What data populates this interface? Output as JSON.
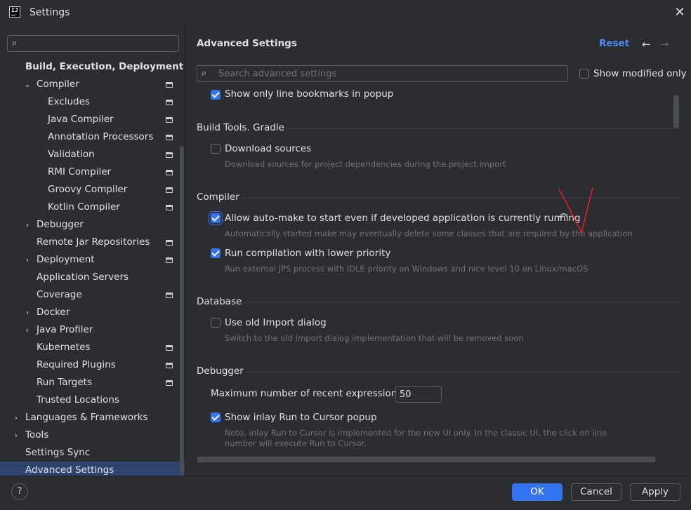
{
  "window": {
    "title": "Settings",
    "app_icon_text": "IJ",
    "close_glyph": "✕"
  },
  "sidebar": {
    "search_placeholder": "",
    "items": [
      {
        "label": "Build, Execution, Deployment",
        "indent": 0,
        "chevron": "",
        "project": false,
        "bold": true,
        "selected": false
      },
      {
        "label": "Compiler",
        "indent": 1,
        "chevron": "⌄",
        "project": true,
        "bold": false,
        "selected": false
      },
      {
        "label": "Excludes",
        "indent": 2,
        "chevron": "",
        "project": true,
        "bold": false,
        "selected": false
      },
      {
        "label": "Java Compiler",
        "indent": 2,
        "chevron": "",
        "project": true,
        "bold": false,
        "selected": false
      },
      {
        "label": "Annotation Processors",
        "indent": 2,
        "chevron": "",
        "project": true,
        "bold": false,
        "selected": false
      },
      {
        "label": "Validation",
        "indent": 2,
        "chevron": "",
        "project": true,
        "bold": false,
        "selected": false
      },
      {
        "label": "RMI Compiler",
        "indent": 2,
        "chevron": "",
        "project": true,
        "bold": false,
        "selected": false
      },
      {
        "label": "Groovy Compiler",
        "indent": 2,
        "chevron": "",
        "project": true,
        "bold": false,
        "selected": false
      },
      {
        "label": "Kotlin Compiler",
        "indent": 2,
        "chevron": "",
        "project": true,
        "bold": false,
        "selected": false
      },
      {
        "label": "Debugger",
        "indent": 1,
        "chevron": "›",
        "project": false,
        "bold": false,
        "selected": false
      },
      {
        "label": "Remote Jar Repositories",
        "indent": 1,
        "chevron": "",
        "project": true,
        "bold": false,
        "selected": false
      },
      {
        "label": "Deployment",
        "indent": 1,
        "chevron": "›",
        "project": true,
        "bold": false,
        "selected": false
      },
      {
        "label": "Application Servers",
        "indent": 1,
        "chevron": "",
        "project": false,
        "bold": false,
        "selected": false
      },
      {
        "label": "Coverage",
        "indent": 1,
        "chevron": "",
        "project": true,
        "bold": false,
        "selected": false
      },
      {
        "label": "Docker",
        "indent": 1,
        "chevron": "›",
        "project": false,
        "bold": false,
        "selected": false
      },
      {
        "label": "Java Profiler",
        "indent": 1,
        "chevron": "›",
        "project": false,
        "bold": false,
        "selected": false
      },
      {
        "label": "Kubernetes",
        "indent": 1,
        "chevron": "",
        "project": true,
        "bold": false,
        "selected": false
      },
      {
        "label": "Required Plugins",
        "indent": 1,
        "chevron": "",
        "project": true,
        "bold": false,
        "selected": false
      },
      {
        "label": "Run Targets",
        "indent": 1,
        "chevron": "",
        "project": true,
        "bold": false,
        "selected": false
      },
      {
        "label": "Trusted Locations",
        "indent": 1,
        "chevron": "",
        "project": false,
        "bold": false,
        "selected": false
      },
      {
        "label": "Languages & Frameworks",
        "indent": 0,
        "chevron": "›",
        "project": false,
        "bold": false,
        "selected": false
      },
      {
        "label": "Tools",
        "indent": 0,
        "chevron": "›",
        "project": false,
        "bold": false,
        "selected": false
      },
      {
        "label": "Settings Sync",
        "indent": 0,
        "chevron": "",
        "project": false,
        "bold": false,
        "selected": false
      },
      {
        "label": "Advanced Settings",
        "indent": 0,
        "chevron": "",
        "project": false,
        "bold": false,
        "selected": true
      }
    ]
  },
  "main": {
    "title": "Advanced Settings",
    "reset_label": "Reset",
    "back_glyph": "←",
    "forward_glyph": "→",
    "search_placeholder": "Search advanced settings",
    "show_modified_label": "Show modified only",
    "show_modified_checked": false,
    "top_option": {
      "label": "Show only line bookmarks in popup",
      "checked": true
    },
    "groups": {
      "gradle": {
        "title": "Build Tools. Gradle",
        "download_sources": {
          "label": "Download sources",
          "checked": false,
          "description": "Download sources for project dependencies during the project import"
        }
      },
      "compiler": {
        "title": "Compiler",
        "auto_make": {
          "label": "Allow auto-make to start even if developed application is currently running",
          "checked": true,
          "description": "Automatically started make may eventually delete some classes that are required by the application"
        },
        "lower_priority": {
          "label": "Run compilation with lower priority",
          "checked": true,
          "description": "Run external JPS process with IDLE priority on Windows and nice level 10 on Linux/macOS"
        }
      },
      "database": {
        "title": "Database",
        "old_import": {
          "label": "Use old Import dialog",
          "checked": false,
          "description": "Switch to the old Import dialog implementation that will be removed soon"
        }
      },
      "debugger": {
        "title": "Debugger",
        "max_expr_label": "Maximum number of recent expressions:",
        "max_expr_value": "50",
        "inlay_run": {
          "label": "Show inlay Run to Cursor popup",
          "checked": true,
          "description_line1": "Note, inlay Run to Cursor is implemented for the new UI only. In the classic UI, the click on line",
          "description_line2": "number will execute Run to Cursor."
        }
      }
    },
    "undo_glyph": "↶",
    "annotation_color": "#e0202a"
  },
  "footer": {
    "help_label": "?",
    "ok_label": "OK",
    "cancel_label": "Cancel",
    "apply_label": "Apply"
  },
  "colors": {
    "accent": "#3574f0",
    "link": "#548af7",
    "selection": "#2e436e",
    "background": "#2b2d30"
  }
}
